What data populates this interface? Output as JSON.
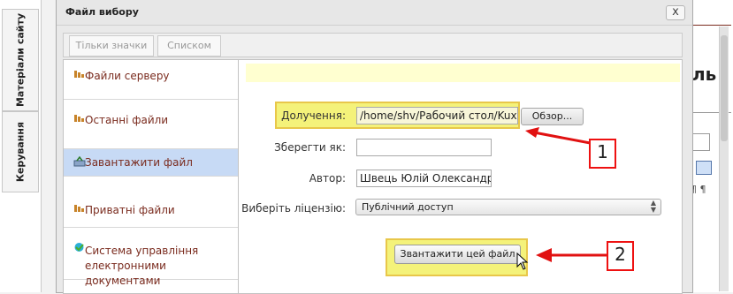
{
  "left_tabs": [
    "Матеріали сайту",
    "Керування"
  ],
  "background_page": {
    "partial_text": "ль"
  },
  "dialog": {
    "title": "Файл вибору",
    "close_label": "x",
    "view_buttons": [
      "Тільки значки",
      "Списком"
    ]
  },
  "sidebar": {
    "items": [
      {
        "label": "Файли серверу",
        "icon": "server-files-icon"
      },
      {
        "label": "Останні файли",
        "icon": "recent-files-icon"
      },
      {
        "label": "Завантажити файл",
        "icon": "upload-icon",
        "active": true
      },
      {
        "label": "Приватні файли",
        "icon": "private-files-icon"
      },
      {
        "label": "Система управління електронними документами",
        "icon": "document-system-icon"
      }
    ]
  },
  "form": {
    "attachment_label": "Долучення:",
    "attachment_value": "/home/shv/Рабочий стол/Kuxar",
    "browse_label": "Обзор...",
    "save_as_label": "Зберегти як:",
    "save_as_value": "",
    "author_label": "Автор:",
    "author_value": "Швець Юлій Олександров",
    "license_label": "Виберіть ліцензію:",
    "license_value": "Публічний доступ",
    "upload_label": "Звантажити цей файл"
  },
  "annotations": {
    "callout_1": "1",
    "callout_2": "2"
  },
  "colors": {
    "callout_red": "#e11111",
    "highlight_yellow": "#f4f27a",
    "active_item": "#c7daf5"
  }
}
